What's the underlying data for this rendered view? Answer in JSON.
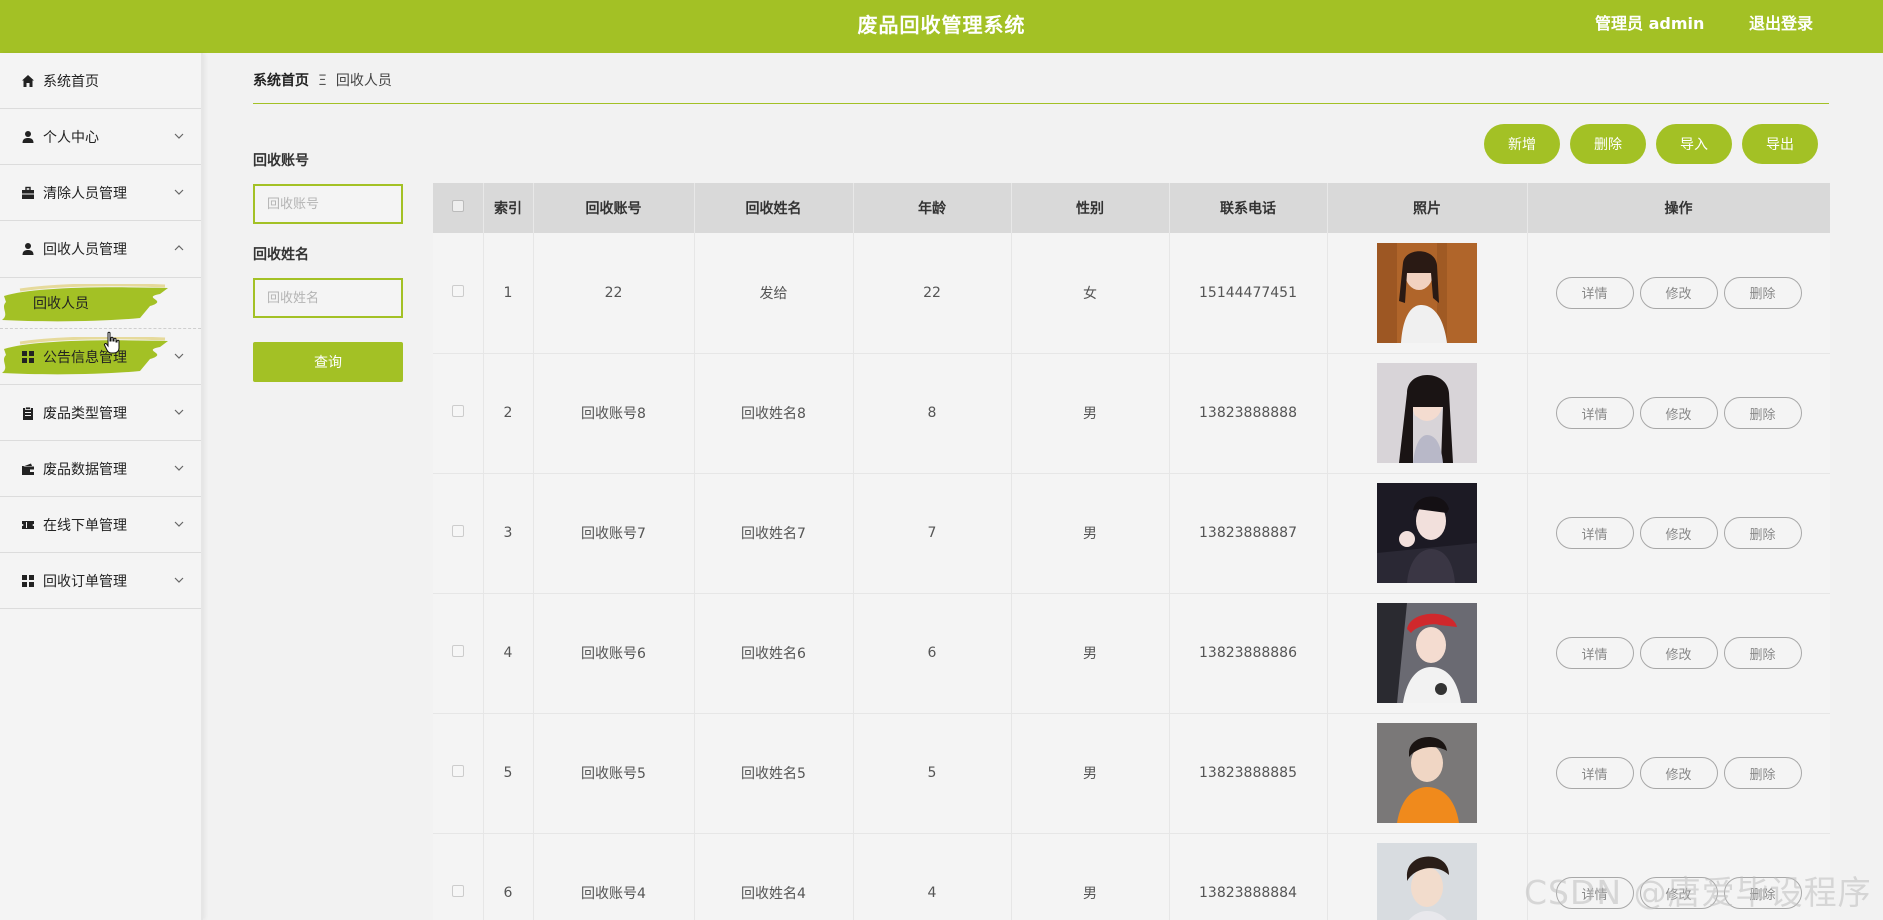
{
  "header": {
    "title": "废品回收管理系统",
    "user": "管理员 admin",
    "logout": "退出登录",
    "accent": "#a3c125"
  },
  "sidebar": {
    "items": [
      {
        "label": "系统首页",
        "icon": "home-icon"
      },
      {
        "label": "个人中心",
        "icon": "user-icon"
      },
      {
        "label": "清除人员管理",
        "icon": "briefcase-icon"
      },
      {
        "label": "回收人员管理",
        "icon": "user-icon"
      },
      {
        "label": "公告信息管理",
        "icon": "grid-icon"
      },
      {
        "label": "废品类型管理",
        "icon": "clipboard-icon"
      },
      {
        "label": "废品数据管理",
        "icon": "wallet-icon"
      },
      {
        "label": "在线下单管理",
        "icon": "ticket-icon"
      },
      {
        "label": "回收订单管理",
        "icon": "grid-icon"
      }
    ],
    "sub_item": "回收人员"
  },
  "breadcrumb": {
    "home": "系统首页",
    "separator": "Ξ",
    "current": "回收人员"
  },
  "search": {
    "account_label": "回收账号",
    "account_placeholder": "回收账号",
    "name_label": "回收姓名",
    "name_placeholder": "回收姓名",
    "query_button": "查询"
  },
  "actions": {
    "add": "新增",
    "delete": "删除",
    "import": "导入",
    "export": "导出"
  },
  "table": {
    "headers": [
      "索引",
      "回收账号",
      "回收姓名",
      "年龄",
      "性别",
      "联系电话",
      "照片",
      "操作"
    ],
    "ops": {
      "detail": "详情",
      "edit": "修改",
      "delete": "删除"
    },
    "rows": [
      {
        "index": "1",
        "account": "22",
        "name": "发给",
        "age": "22",
        "gender": "女",
        "phone": "15144477451"
      },
      {
        "index": "2",
        "account": "回收账号8",
        "name": "回收姓名8",
        "age": "8",
        "gender": "男",
        "phone": "13823888888"
      },
      {
        "index": "3",
        "account": "回收账号7",
        "name": "回收姓名7",
        "age": "7",
        "gender": "男",
        "phone": "13823888887"
      },
      {
        "index": "4",
        "account": "回收账号6",
        "name": "回收姓名6",
        "age": "6",
        "gender": "男",
        "phone": "13823888886"
      },
      {
        "index": "5",
        "account": "回收账号5",
        "name": "回收姓名5",
        "age": "5",
        "gender": "男",
        "phone": "13823888885"
      },
      {
        "index": "6",
        "account": "回收账号4",
        "name": "回收姓名4",
        "age": "4",
        "gender": "男",
        "phone": "13823888884"
      }
    ]
  },
  "watermark": "CSDN @唐爱毕设程序"
}
